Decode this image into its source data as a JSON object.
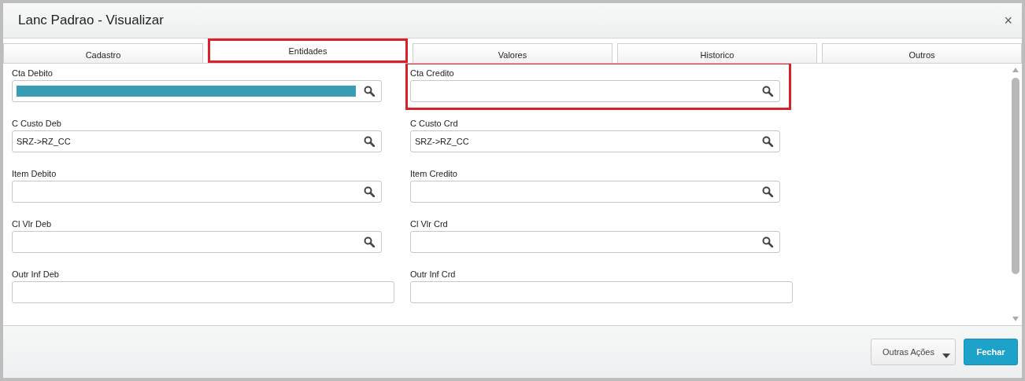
{
  "window": {
    "title": "Lanc Padrao - Visualizar",
    "close": "×"
  },
  "tabs": [
    {
      "label": "Cadastro",
      "selected": false,
      "highlighted": false
    },
    {
      "label": "Entidades",
      "selected": true,
      "highlighted": true
    },
    {
      "label": "Valores",
      "selected": false,
      "highlighted": false
    },
    {
      "label": "Historico",
      "selected": false,
      "highlighted": false
    },
    {
      "label": "Outros",
      "selected": false,
      "highlighted": false
    }
  ],
  "fields": [
    {
      "label": "Cta Debito",
      "value_redacted": true,
      "search": true,
      "highlighted": false
    },
    {
      "label": "Cta Credito",
      "search": true,
      "highlighted": true
    },
    {
      "label": "C Custo Deb",
      "value": "SRZ->RZ_CC",
      "search": true,
      "highlighted": false
    },
    {
      "label": "C Custo Crd",
      "value": "SRZ->RZ_CC",
      "search": true,
      "highlighted": false
    },
    {
      "label": "Item Debito",
      "search": true,
      "highlighted": false
    },
    {
      "label": "Item Credito",
      "search": true,
      "highlighted": false
    },
    {
      "label": "Cl Vlr Deb",
      "search": true,
      "highlighted": false
    },
    {
      "label": "Cl Vlr Crd",
      "search": true,
      "highlighted": false
    },
    {
      "label": "Outr Inf Deb",
      "search": false,
      "highlighted": false
    },
    {
      "label": "Outr Inf Crd",
      "search": false,
      "highlighted": false
    }
  ],
  "buttons": [
    {
      "label": "Outras Ações",
      "kind": "menu"
    },
    {
      "label": "Fechar",
      "kind": "primary"
    }
  ]
}
